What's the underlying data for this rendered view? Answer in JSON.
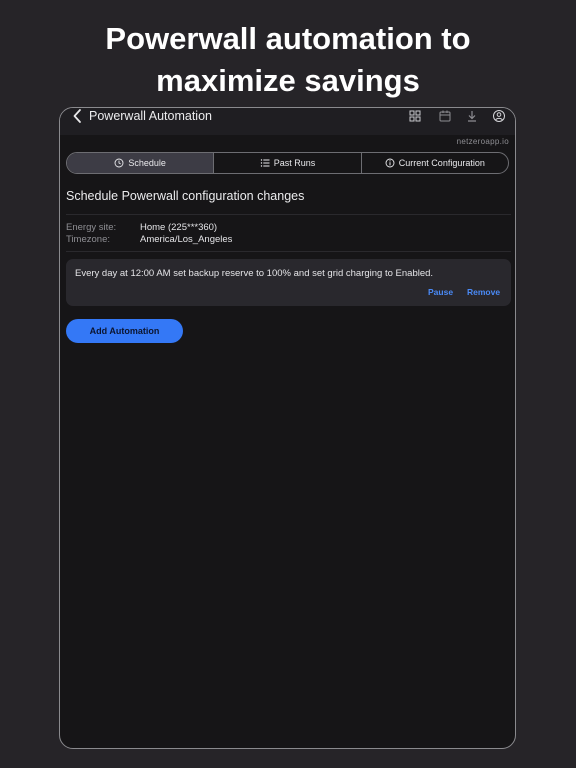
{
  "headline": [
    "Powerwall automation to",
    "maximize savings"
  ],
  "nav": {
    "title": "Powerwall Automation",
    "icons": [
      "chevron-left-icon",
      "grid-icon",
      "calendar-icon",
      "download-icon",
      "account-icon"
    ]
  },
  "domain": "netzeroapp.io",
  "tabs": [
    {
      "label": "Schedule",
      "icon": "clock-icon",
      "active": true
    },
    {
      "label": "Past Runs",
      "icon": "list-icon",
      "active": false
    },
    {
      "label": "Current Configuration",
      "icon": "info-icon",
      "active": false
    }
  ],
  "section_title": "Schedule Powerwall configuration changes",
  "info": {
    "energy_site_label": "Energy site:",
    "energy_site_value": "Home (225***360)",
    "timezone_label": "Timezone:",
    "timezone_value": "America/Los_Angeles"
  },
  "automation": {
    "description": "Every day at 12:00 AM set backup reserve to 100% and set grid charging to Enabled.",
    "pause_label": "Pause",
    "remove_label": "Remove"
  },
  "add_button_label": "Add Automation",
  "colors": {
    "background": "#262428",
    "device_bg": "#161517",
    "accent": "#3478f6",
    "link": "#4a8af6",
    "card_bg": "#29282d"
  }
}
